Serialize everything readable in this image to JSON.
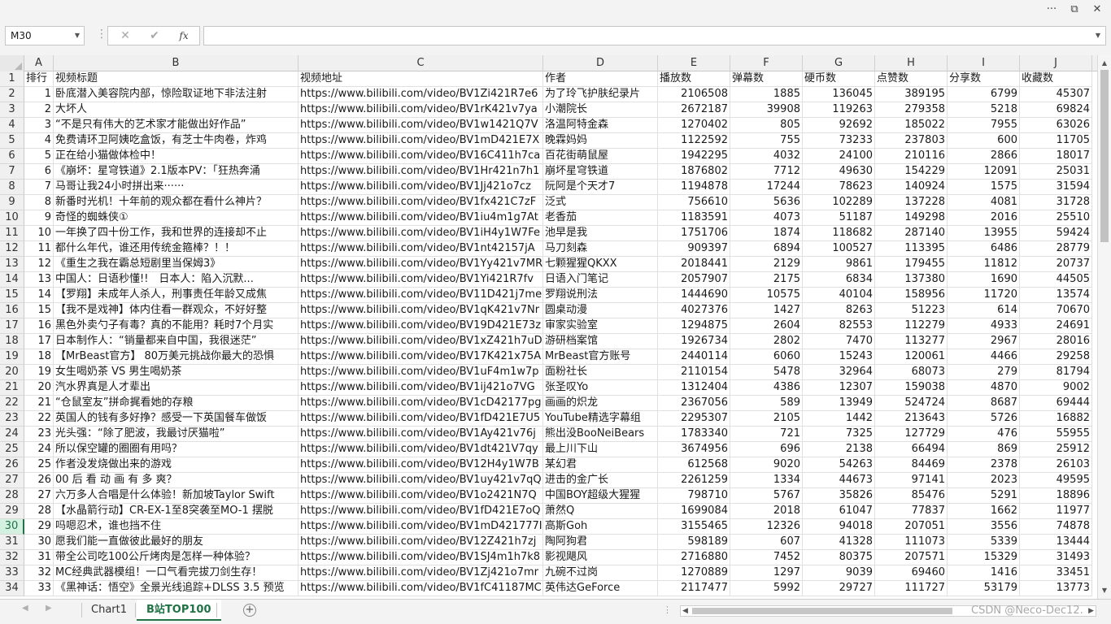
{
  "window": {
    "more_label": "···",
    "restore_label": "⧉",
    "close_label": "✕"
  },
  "formula_bar": {
    "name_box": "M30",
    "cancel_label": "✕",
    "confirm_label": "✔",
    "fx_label": "fx",
    "formula_value": ""
  },
  "sheet": {
    "columns": [
      "A",
      "B",
      "C",
      "D",
      "E",
      "F",
      "G",
      "H",
      "I",
      "J"
    ],
    "selected_row": 30,
    "rows": [
      {
        "n": 1,
        "a": "排行",
        "b": "视频标题",
        "c": "视频地址",
        "d": "作者",
        "e": "播放数",
        "f": "弹幕数",
        "g": "硬币数",
        "h": "点赞数",
        "i": "分享数",
        "j": "收藏数"
      },
      {
        "n": 2,
        "a": "1",
        "b": "卧底潜入美容院内部，惊险取证地下非法注射",
        "c": "https://www.bilibili.com/video/BV1Zi421R7e6",
        "d": "为了玲飞护肤纪录片",
        "e": "2106508",
        "f": "1885",
        "g": "136045",
        "h": "389195",
        "i": "6799",
        "j": "45307"
      },
      {
        "n": 3,
        "a": "2",
        "b": "大坏人",
        "c": "https://www.bilibili.com/video/BV1rK421v7ya",
        "d": "小潮院长",
        "e": "2672187",
        "f": "39908",
        "g": "119263",
        "h": "279358",
        "i": "5218",
        "j": "69824"
      },
      {
        "n": 4,
        "a": "3",
        "b": "“不是只有伟大的艺术家才能做出好作品”",
        "c": "https://www.bilibili.com/video/BV1w1421Q7V",
        "d": "洛温阿特金森",
        "e": "1270402",
        "f": "805",
        "g": "92692",
        "h": "185022",
        "i": "7955",
        "j": "63026"
      },
      {
        "n": 5,
        "a": "4",
        "b": "免费请环卫阿姨吃盒饭，有芝士牛肉卷，炸鸡",
        "c": "https://www.bilibili.com/video/BV1mD421E7X",
        "d": "晚霖妈妈",
        "e": "1122592",
        "f": "755",
        "g": "73233",
        "h": "237803",
        "i": "600",
        "j": "11705"
      },
      {
        "n": 6,
        "a": "5",
        "b": "正在给小猫做体检中！",
        "c": "https://www.bilibili.com/video/BV16C411h7ca",
        "d": "百花街萌鼠屋",
        "e": "1942295",
        "f": "4032",
        "g": "24100",
        "h": "210116",
        "i": "2866",
        "j": "18017"
      },
      {
        "n": 7,
        "a": "6",
        "b": "《崩坏：星穹铁道》2.1版本PV：「狂热奔涌",
        "c": "https://www.bilibili.com/video/BV1Hr421n7h1",
        "d": "崩坏星穹铁道",
        "e": "1876802",
        "f": "7712",
        "g": "49630",
        "h": "154229",
        "i": "12091",
        "j": "25031"
      },
      {
        "n": 8,
        "a": "7",
        "b": "马哥让我24小时拼出来······",
        "c": "https://www.bilibili.com/video/BV1Jj421o7cz",
        "d": "阮阿是个天才7",
        "e": "1194878",
        "f": "17244",
        "g": "78623",
        "h": "140924",
        "i": "1575",
        "j": "31594"
      },
      {
        "n": 9,
        "a": "8",
        "b": "新番时光机！十年前的观众都在看什么神片？",
        "c": "https://www.bilibili.com/video/BV1fx421C7zF",
        "d": "泛式",
        "e": "756610",
        "f": "5636",
        "g": "102289",
        "h": "137228",
        "i": "4081",
        "j": "31728"
      },
      {
        "n": 10,
        "a": "9",
        "b": "奇怪的蜘蛛侠①",
        "c": "https://www.bilibili.com/video/BV1iu4m1g7At",
        "d": "老香茄",
        "e": "1183591",
        "f": "4073",
        "g": "51187",
        "h": "149298",
        "i": "2016",
        "j": "25510"
      },
      {
        "n": 11,
        "a": "10",
        "b": "一年换了四十份工作，我和世界的连接却不止",
        "c": "https://www.bilibili.com/video/BV1iH4y1W7Fe",
        "d": "池早是我",
        "e": "1751706",
        "f": "1874",
        "g": "118682",
        "h": "287140",
        "i": "13955",
        "j": "59424"
      },
      {
        "n": 12,
        "a": "11",
        "b": "都什么年代，谁还用传统金箍棒？！！",
        "c": "https://www.bilibili.com/video/BV1nt42157jA",
        "d": "马刀刻森",
        "e": "909397",
        "f": "6894",
        "g": "100527",
        "h": "113395",
        "i": "6486",
        "j": "28779"
      },
      {
        "n": 13,
        "a": "12",
        "b": "《重生之我在霸总短剧里当保姆3》",
        "c": "https://www.bilibili.com/video/BV1Yy421v7MR",
        "d": "七颗猩猩QKXX",
        "e": "2018441",
        "f": "2129",
        "g": "9861",
        "h": "179455",
        "i": "11812",
        "j": "20737"
      },
      {
        "n": 14,
        "a": "13",
        "b": "中国人：日语秒懂!!　日本人：陷入沉默...",
        "c": "https://www.bilibili.com/video/BV1Yi421R7fv",
        "d": "日语入门笔记",
        "e": "2057907",
        "f": "2175",
        "g": "6834",
        "h": "137380",
        "i": "1690",
        "j": "44505"
      },
      {
        "n": 15,
        "a": "14",
        "b": "【罗翔】未成年人杀人，刑事责任年龄又成焦",
        "c": "https://www.bilibili.com/video/BV11D421j7me",
        "d": "罗翔说刑法",
        "e": "1444690",
        "f": "10575",
        "g": "40104",
        "h": "158956",
        "i": "11720",
        "j": "13574"
      },
      {
        "n": 16,
        "a": "15",
        "b": "【我不是戏神】体内住看一群观众，不好好整",
        "c": "https://www.bilibili.com/video/BV1qK421v7Nr",
        "d": "圆桌动漫",
        "e": "4027376",
        "f": "1427",
        "g": "8263",
        "h": "51223",
        "i": "614",
        "j": "70670"
      },
      {
        "n": 17,
        "a": "16",
        "b": "黑色外卖勺子有毒？真的不能用？耗时7个月实",
        "c": "https://www.bilibili.com/video/BV19D421E73z",
        "d": "审家实验室",
        "e": "1294875",
        "f": "2604",
        "g": "82553",
        "h": "112279",
        "i": "4933",
        "j": "24691"
      },
      {
        "n": 18,
        "a": "17",
        "b": "日本制作人：“销量都来自中国，我很迷茫”",
        "c": "https://www.bilibili.com/video/BV1xZ421h7uD",
        "d": "游研档案馆",
        "e": "1926734",
        "f": "2802",
        "g": "7470",
        "h": "113277",
        "i": "2967",
        "j": "28016"
      },
      {
        "n": 19,
        "a": "18",
        "b": "【MrBeast官方】 80万美元挑战你最大的恐惧",
        "c": "https://www.bilibili.com/video/BV17K421x75A",
        "d": "MrBeast官方账号",
        "e": "2440114",
        "f": "6060",
        "g": "15243",
        "h": "120061",
        "i": "4466",
        "j": "29258"
      },
      {
        "n": 20,
        "a": "19",
        "b": "女生喝奶茶 VS 男生喝奶茶",
        "c": "https://www.bilibili.com/video/BV1uF4m1w7p",
        "d": "面粉社长",
        "e": "2110154",
        "f": "5478",
        "g": "32964",
        "h": "68073",
        "i": "279",
        "j": "81794"
      },
      {
        "n": 21,
        "a": "20",
        "b": "汽水界真是人才辈出",
        "c": "https://www.bilibili.com/video/BV1ij421o7VG",
        "d": "张圣叹Yo",
        "e": "1312404",
        "f": "4386",
        "g": "12307",
        "h": "159038",
        "i": "4870",
        "j": "9002"
      },
      {
        "n": 22,
        "a": "21",
        "b": "“仓鼠室友”拼命捤看她的存粮",
        "c": "https://www.bilibili.com/video/BV1cD42177pg",
        "d": "画画的炽龙",
        "e": "2367056",
        "f": "589",
        "g": "13949",
        "h": "524724",
        "i": "8687",
        "j": "69444"
      },
      {
        "n": 23,
        "a": "22",
        "b": "英国人的钱有多好挣？感受一下英国餐车做饭",
        "c": "https://www.bilibili.com/video/BV1fD421E7U5",
        "d": "YouTube精选字幕组",
        "e": "2295307",
        "f": "2105",
        "g": "1442",
        "h": "213643",
        "i": "5726",
        "j": "16882"
      },
      {
        "n": 24,
        "a": "23",
        "b": "光头强：“除了肥波，我最讨厌猫啦”",
        "c": "https://www.bilibili.com/video/BV1Ay421v76j",
        "d": "熊出没BooNeiBears",
        "e": "1783340",
        "f": "721",
        "g": "7325",
        "h": "127729",
        "i": "476",
        "j": "55955"
      },
      {
        "n": 25,
        "a": "24",
        "b": "所以保空罐的圈圈有用吗？",
        "c": "https://www.bilibili.com/video/BV1dt421V7qy",
        "d": "最上川下山",
        "e": "3674956",
        "f": "696",
        "g": "2138",
        "h": "66494",
        "i": "869",
        "j": "25912"
      },
      {
        "n": 26,
        "a": "25",
        "b": "作者没发烧做出来的游戏",
        "c": "https://www.bilibili.com/video/BV12H4y1W7B",
        "d": "某幻君",
        "e": "612568",
        "f": "9020",
        "g": "54263",
        "h": "84469",
        "i": "2378",
        "j": "26103"
      },
      {
        "n": 27,
        "a": "26",
        "b": "00 后 看 动 画 有 多 爽？",
        "c": "https://www.bilibili.com/video/BV1uy421v7qQ",
        "d": "进击的金广长",
        "e": "2261259",
        "f": "1334",
        "g": "44673",
        "h": "97141",
        "i": "2023",
        "j": "49595"
      },
      {
        "n": 28,
        "a": "27",
        "b": "六万多人合唱是什么体验！新加坡Taylor Swift",
        "c": "https://www.bilibili.com/video/BV1o2421N7Q",
        "d": "中国BOY超级大猩猩",
        "e": "798710",
        "f": "5767",
        "g": "35826",
        "h": "85476",
        "i": "5291",
        "j": "18896"
      },
      {
        "n": 29,
        "a": "28",
        "b": "【水晶箭行动】CR-EX-1至8突袭至MO-1 摆脱",
        "c": "https://www.bilibili.com/video/BV1fD421E7oQ",
        "d": "萧然Q",
        "e": "1699084",
        "f": "2018",
        "g": "61047",
        "h": "77837",
        "i": "1662",
        "j": "11977"
      },
      {
        "n": 30,
        "a": "29",
        "b": "吗嗯忍术，谁也挡不住",
        "c": "https://www.bilibili.com/video/BV1mD421777I",
        "d": "高斯Goh",
        "e": "3155465",
        "f": "12326",
        "g": "94018",
        "h": "207051",
        "i": "3556",
        "j": "74878"
      },
      {
        "n": 31,
        "a": "30",
        "b": "愿我们能一直做彼此最好的朋友",
        "c": "https://www.bilibili.com/video/BV12Z421h7zj",
        "d": "陶阿狗君",
        "e": "598189",
        "f": "607",
        "g": "41328",
        "h": "111073",
        "i": "5339",
        "j": "13444"
      },
      {
        "n": 32,
        "a": "31",
        "b": "带全公司吃100公斤烤肉是怎样一种体验？",
        "c": "https://www.bilibili.com/video/BV1SJ4m1h7k8",
        "d": "影视飓风",
        "e": "2716880",
        "f": "7452",
        "g": "80375",
        "h": "207571",
        "i": "15329",
        "j": "31493"
      },
      {
        "n": 33,
        "a": "32",
        "b": "MC经典武器模组！一口气看完拔刀剑生存！",
        "c": "https://www.bilibili.com/video/BV1Zj421o7mr",
        "d": "九碗不过岗",
        "e": "1270889",
        "f": "1297",
        "g": "9039",
        "h": "69460",
        "i": "1416",
        "j": "33451"
      },
      {
        "n": 34,
        "a": "33",
        "b": "《黑神话：悟空》全景光线追踪+DLSS 3.5 预览",
        "c": "https://www.bilibili.com/video/BV1fC41187MC",
        "d": "英伟达GeForce",
        "e": "2117477",
        "f": "5992",
        "g": "29727",
        "h": "111727",
        "i": "53179",
        "j": "13773"
      }
    ]
  },
  "tabs": {
    "sheet1": "Chart1",
    "sheet2": "B站TOP100",
    "add_label": "+",
    "more_label": "⋮"
  },
  "scrollbar": {
    "up_label": "▲",
    "down_label": "▼",
    "left_label": "◀",
    "right_label": "▶"
  },
  "watermark": "CSDN @Neco-Dec12.",
  "colors": {
    "accent": "#217346",
    "header_bg": "#f0f0f0",
    "grid_line": "#e0e0e0"
  }
}
